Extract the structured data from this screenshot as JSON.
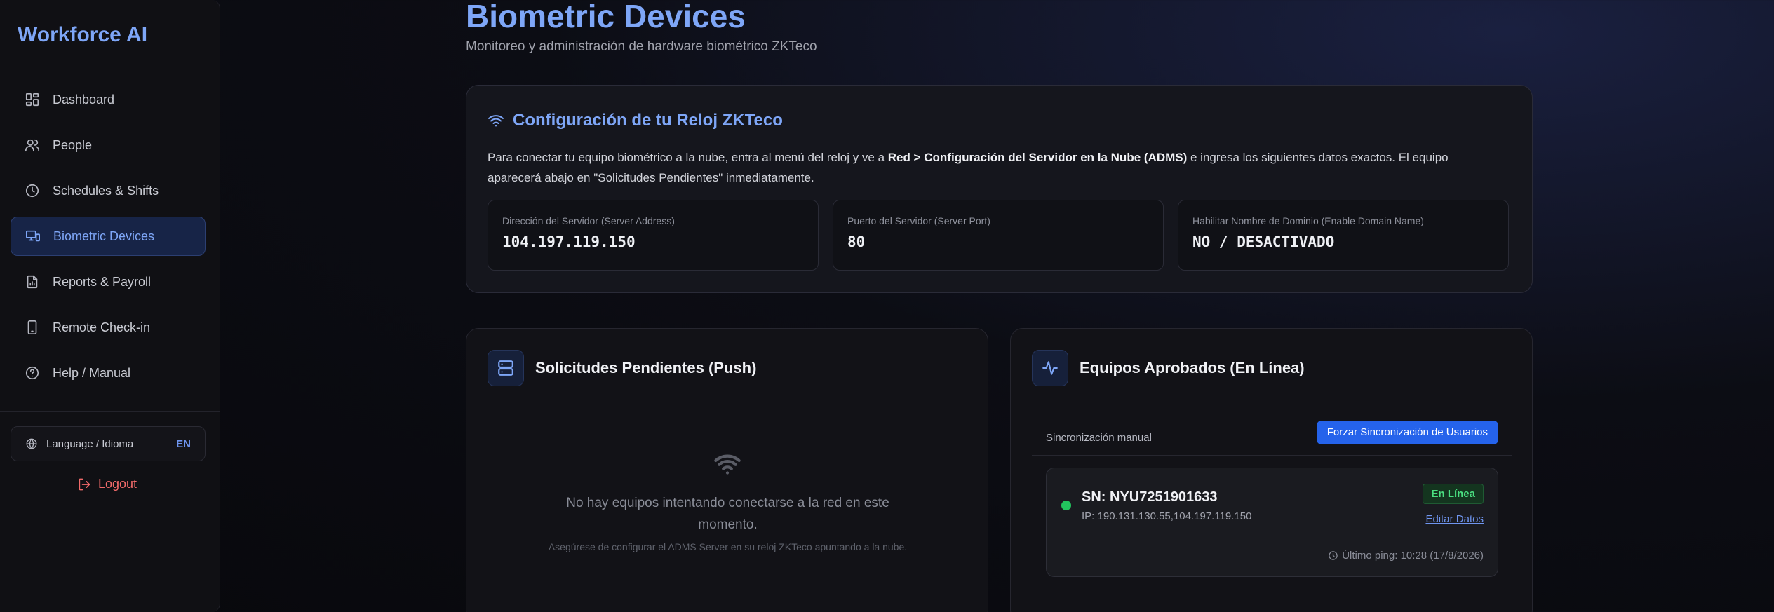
{
  "sidebar": {
    "brand": "Workforce AI",
    "items": [
      {
        "label": "Dashboard",
        "icon": "dashboard-icon"
      },
      {
        "label": "People",
        "icon": "users-icon"
      },
      {
        "label": "Schedules & Shifts",
        "icon": "clock-icon"
      },
      {
        "label": "Biometric Devices",
        "icon": "devices-icon",
        "active": true
      },
      {
        "label": "Reports & Payroll",
        "icon": "report-icon"
      },
      {
        "label": "Remote Check-in",
        "icon": "smartphone-icon"
      },
      {
        "label": "Help / Manual",
        "icon": "help-icon"
      }
    ],
    "language": {
      "label": "Language / Idioma",
      "code": "EN"
    },
    "logout": "Logout"
  },
  "header": {
    "title": "Biometric Devices",
    "subtitle": "Monitoreo y administración de hardware biométrico ZKTeco"
  },
  "config": {
    "title": "Configuración de tu Reloj ZKTeco",
    "desc_1": "Para conectar tu equipo biométrico a la nube, entra al menú del reloj y ve a ",
    "desc_bold": "Red > Configuración del Servidor en la Nube (ADMS)",
    "desc_2": " e ingresa los siguientes datos exactos. El equipo aparecerá abajo en \"Solicitudes Pendientes\" inmediatamente.",
    "fields": [
      {
        "label": "Dirección del Servidor (Server Address)",
        "value": "104.197.119.150"
      },
      {
        "label": "Puerto del Servidor (Server Port)",
        "value": "80"
      },
      {
        "label": "Habilitar Nombre de Dominio (Enable Domain Name)",
        "value": "NO / DESACTIVADO"
      }
    ]
  },
  "pending": {
    "title": "Solicitudes Pendientes (Push)",
    "empty_text": "No hay equipos intentando conectarse a la red en este momento.",
    "empty_hint": "Asegúrese de configurar el ADMS Server en su reloj ZKTeco apuntando a la nube."
  },
  "approved": {
    "title": "Equipos Aprobados (En Línea)",
    "sync_label": "Sincronización manual",
    "sync_button": "Forzar Sincronización de Usuarios",
    "device": {
      "sn": "SN: NYU7251901633",
      "ip": "IP: 190.131.130.55,104.197.119.150",
      "status": "En Línea",
      "edit": "Editar Datos",
      "ping": "Último ping: 10:28 (17/8/2026)"
    }
  },
  "colors": {
    "accent": "#7ea6f7",
    "primary_button": "#2563eb",
    "online": "#22c55e",
    "logout": "#f16a6a"
  }
}
